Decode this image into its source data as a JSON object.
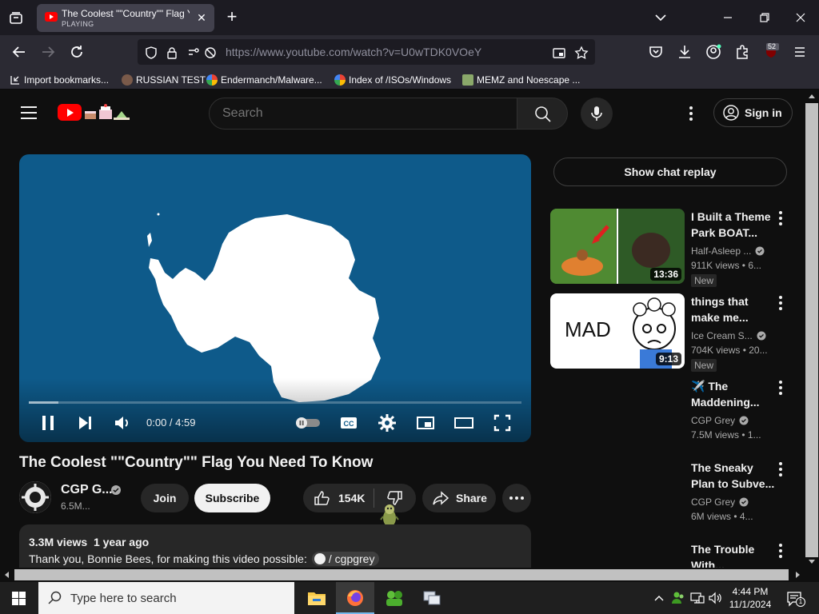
{
  "browser": {
    "tab": {
      "title": "The Coolest \"\"Country\"\" Flag You",
      "status": "PLAYING"
    },
    "url": "https://www.youtube.com/watch?v=U0wTDK0VOeY",
    "extension_badge": "52",
    "bookmarks": [
      {
        "label": "Import bookmarks...",
        "icon": "import-icon"
      },
      {
        "label": "RUSSIAN TEST",
        "icon": "favicon-icon"
      },
      {
        "label": "Endermanch/Malware...",
        "icon": "google-icon"
      },
      {
        "label": "Index of /ISOs/Windows",
        "icon": "google-icon"
      },
      {
        "label": "MEMZ and Noescape ...",
        "icon": "image-icon"
      }
    ]
  },
  "youtube": {
    "search_placeholder": "Search",
    "sign_in": "Sign in",
    "player": {
      "time_current": "0:00",
      "time_total": "4:59",
      "progress_fraction": 0.06,
      "state": "playing"
    },
    "video": {
      "title": "The Coolest \"\"Country\"\" Flag You Need To Know",
      "channel": "CGP G...",
      "subscribers": "6.5M...",
      "join": "Join",
      "subscribe": "Subscribe",
      "likes": "154K",
      "share": "Share",
      "views": "3.3M views",
      "age": "1 year ago",
      "description": "Thank you, Bonnie Bees, for making this video possible:",
      "handle": "/ cgpgrey"
    },
    "chat_replay": "Show chat replay",
    "recommendations": [
      {
        "title1": "I Built a Theme",
        "title2": "Park BOAT...",
        "channel": "Half-Asleep ...",
        "meta": "911K views  •  6...",
        "duration": "13:36",
        "badge": "New"
      },
      {
        "title1": "things that",
        "title2": "make me...",
        "channel": "Ice Cream S...",
        "meta": "704K views  •  20...",
        "duration": "9:13",
        "badge": "New"
      },
      {
        "title1": "✈️ The",
        "title2": "Maddening...",
        "channel": "CGP Grey",
        "meta": "7.5M views  •  1..."
      },
      {
        "title1": "The Sneaky",
        "title2": "Plan to Subve...",
        "channel": "CGP Grey",
        "meta": "6M views  •  4..."
      },
      {
        "title1": "The Trouble",
        "title2": "With..."
      }
    ]
  },
  "taskbar": {
    "search_placeholder": "Type here to search",
    "time": "4:44 PM",
    "date": "11/1/2024",
    "notification_count": "1"
  }
}
